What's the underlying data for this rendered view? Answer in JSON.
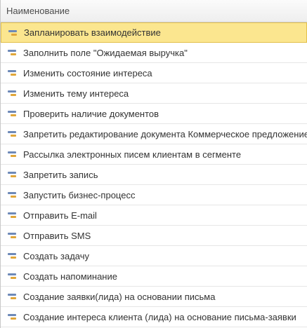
{
  "list": {
    "header": "Наименование",
    "items": [
      {
        "label": "Запланировать взаимодействие",
        "selected": true
      },
      {
        "label": "Заполнить  поле \"Ожидаемая  выручка\"",
        "selected": false
      },
      {
        "label": "Изменить состояние интереса",
        "selected": false
      },
      {
        "label": "Изменить тему интереса",
        "selected": false
      },
      {
        "label": "Проверить наличие документов",
        "selected": false
      },
      {
        "label": "Запретить редактирование документа Коммерческое предложение",
        "selected": false
      },
      {
        "label": "Рассылка электронных писем  клиентам в сегменте",
        "selected": false
      },
      {
        "label": "Запретить запись",
        "selected": false
      },
      {
        "label": "Запустить бизнес-процесс",
        "selected": false
      },
      {
        "label": "Отправить E-mail",
        "selected": false
      },
      {
        "label": "Отправить SMS",
        "selected": false
      },
      {
        "label": "Создать задачу",
        "selected": false
      },
      {
        "label": "Создать напоминание",
        "selected": false
      },
      {
        "label": "Создание заявки(лида) на основании письма",
        "selected": false
      },
      {
        "label": "Создание интереса клиента (лида) на основание письма-заявки",
        "selected": false
      }
    ]
  },
  "colors": {
    "selection": "#fbe68f",
    "selection_border": "#e2c04c",
    "icon_primary": "#6d89b8",
    "icon_secondary": "#e0a63a"
  }
}
